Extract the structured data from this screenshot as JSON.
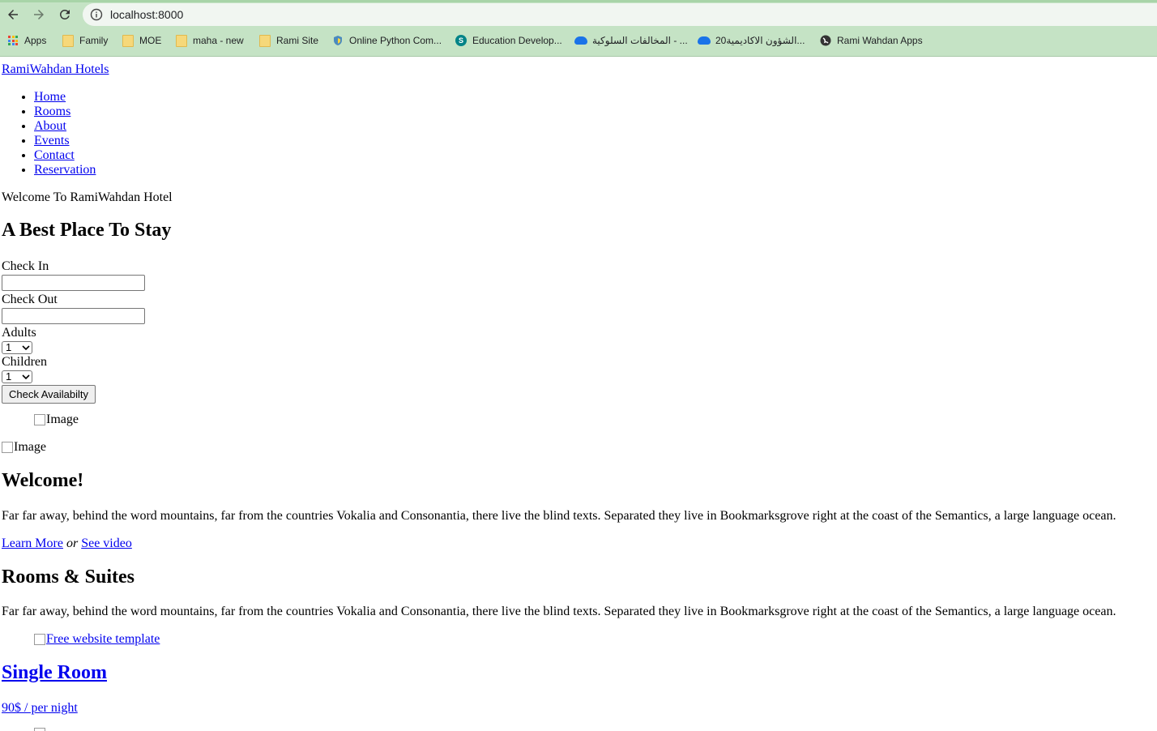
{
  "browser": {
    "url": "localhost:8000",
    "bookmarks": [
      {
        "label": "Apps",
        "icon": "apps-grid-icon"
      },
      {
        "label": "Family",
        "icon": "folder-icon"
      },
      {
        "label": "MOE",
        "icon": "folder-icon"
      },
      {
        "label": "maha - new",
        "icon": "folder-icon"
      },
      {
        "label": "Rami Site",
        "icon": "folder-icon"
      },
      {
        "label": "Online Python Com...",
        "icon": "python-shield-icon"
      },
      {
        "label": "Education Develop...",
        "icon": "sharepoint-icon"
      },
      {
        "label": "المخالفات السلوكية - ...",
        "icon": "onedrive-icon"
      },
      {
        "label": "الشؤون الاكاديمية20...",
        "icon": "onedrive-icon"
      },
      {
        "label": "Rami Wahdan Apps",
        "icon": "globe-icon"
      }
    ]
  },
  "site": {
    "brand": "RamiWahdan Hotels",
    "menu": [
      "Home",
      "Rooms",
      "About",
      "Events",
      "Contact",
      "Reservation"
    ],
    "welcome_line": "Welcome To RamiWahdan Hotel",
    "hero_title": "A Best Place To Stay"
  },
  "form": {
    "check_in_label": "Check In",
    "check_in_value": "",
    "check_out_label": "Check Out",
    "check_out_value": "",
    "adults_label": "Adults",
    "adults_value": "1",
    "children_label": "Children",
    "children_value": "1",
    "submit_label": "Check Availabilty"
  },
  "images": {
    "image_alt": "Image",
    "room_image_alt": "Free website template"
  },
  "welcome": {
    "title": "Welcome!",
    "text": "Far far away, behind the word mountains, far from the countries Vokalia and Consonantia, there live the blind texts. Separated they live in Bookmarksgrove right at the coast of the Semantics, a large language ocean.",
    "learn_more": "Learn More",
    "or": "or",
    "see_video": "See video"
  },
  "rooms": {
    "title": "Rooms & Suites",
    "text": "Far far away, behind the word mountains, far from the countries Vokalia and Consonantia, there live the blind texts. Separated they live in Bookmarksgrove right at the coast of the Semantics, a large language ocean.",
    "room_name": "Single Room",
    "room_price": "90$ / per night"
  },
  "colors": {
    "chrome_bg": "#c5e3c5",
    "link": "#0000ee"
  }
}
